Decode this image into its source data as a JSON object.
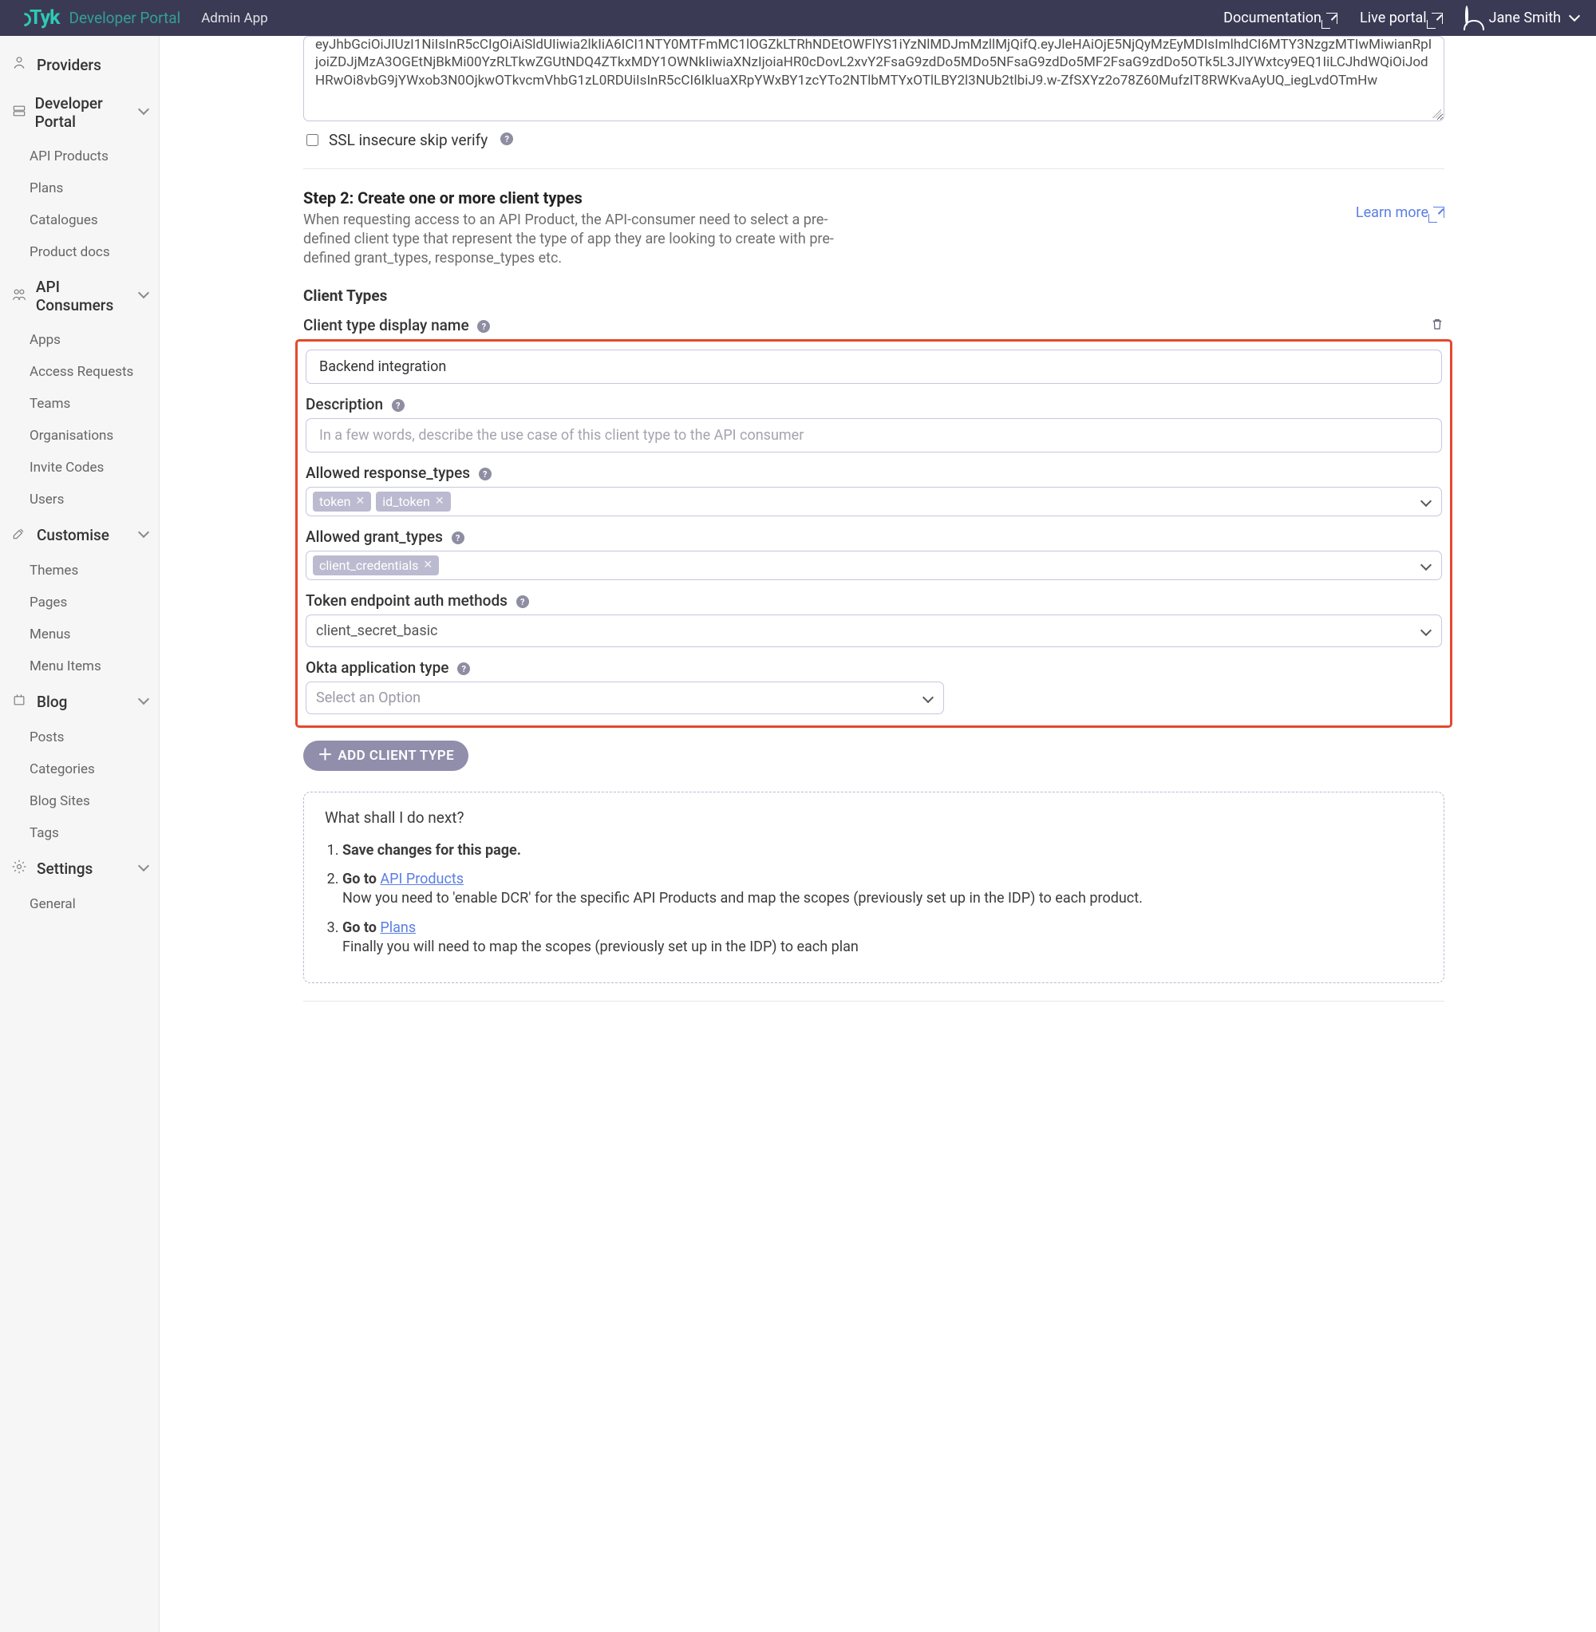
{
  "header": {
    "brand": "Tyk",
    "brand_sub": "Developer Portal",
    "app_name": "Admin App",
    "links": {
      "docs": "Documentation",
      "live": "Live portal"
    },
    "user": "Jane Smith"
  },
  "sidebar": {
    "providers": "Providers",
    "devportal": {
      "label": "Developer Portal",
      "items": [
        "API Products",
        "Plans",
        "Catalogues",
        "Product docs"
      ]
    },
    "consumers": {
      "label": "API Consumers",
      "items": [
        "Apps",
        "Access Requests",
        "Teams",
        "Organisations",
        "Invite Codes",
        "Users"
      ]
    },
    "customise": {
      "label": "Customise",
      "items": [
        "Themes",
        "Pages",
        "Menus",
        "Menu Items"
      ]
    },
    "blog": {
      "label": "Blog",
      "items": [
        "Posts",
        "Categories",
        "Blog Sites",
        "Tags"
      ]
    },
    "settings": {
      "label": "Settings",
      "items": [
        "General"
      ]
    }
  },
  "jwt_preview": "eyJhbGciOiJIUzI1NiIsInR5cCIgOiAiSldUIiwia2lkIiA6ICI1NTY0MTFmMC1lOGZkLTRhNDEtOWFlYS1iYzNlMDJmMzllMjQifQ.eyJleHAiOjE5NjQyMzEyMDIsImlhdCI6MTY3NzgzMTIwMiwianRpIjoiZDJjMzA3OGEtNjBkMi00YzRLTkwZGUtNDQ4ZTkxMDY1OWNkIiwiaXNzIjoiaHR0cDovL2xvY2FsaG9zdDo5MDo5NFsaG9zdDo5MF2FsaG9zdDo5OTk5L3JlYWxtcy9EQ1IiLCJhdWQiOiJodHRwOi8vbG9jYWxob3N0OjkwOTkvcmVhbG1zL0RDUiIsInR5cCI6IkluaXRpYWxBY1zcYTo2NTlbMTYxOTlLBY2l3NUb2tlbiJ9.w-ZfSXYz2o78Z60MufzIT8RWKvaAyUQ_iegLvdOTmHw",
  "ssl_label": "SSL insecure skip verify",
  "step2": {
    "title": "Step 2: Create one or more client types",
    "desc": "When requesting access to an API Product, the API-consumer need to select a pre-defined client type that represent the type of app they are looking to create with pre-defined grant_types, response_types etc.",
    "learn_more": "Learn more"
  },
  "client_types": {
    "section": "Client Types",
    "display_name_label": "Client type display name",
    "display_name_value": "Backend integration",
    "description_label": "Description",
    "description_placeholder": "In a few words, describe the use case of this client type to the API consumer",
    "response_types_label": "Allowed response_types",
    "response_types": [
      "token",
      "id_token"
    ],
    "grant_types_label": "Allowed grant_types",
    "grant_types": [
      "client_credentials"
    ],
    "token_auth_label": "Token endpoint auth methods",
    "token_auth_value": "client_secret_basic",
    "okta_label": "Okta application type",
    "okta_placeholder": "Select an Option",
    "add_btn": "ADD CLIENT TYPE"
  },
  "guide": {
    "heading": "What shall I do next?",
    "items": [
      {
        "lead": "Save changes for this page.",
        "rest": "",
        "link": null
      },
      {
        "lead": "Go to ",
        "rest": "Now you need to 'enable DCR' for the specific API Products and map the scopes (previously set up in the IDP) to each product.",
        "link": "API Products"
      },
      {
        "lead": "Go to ",
        "rest": "Finally you will need to map the scopes (previously set up in the IDP) to each plan",
        "link": "Plans"
      }
    ]
  }
}
